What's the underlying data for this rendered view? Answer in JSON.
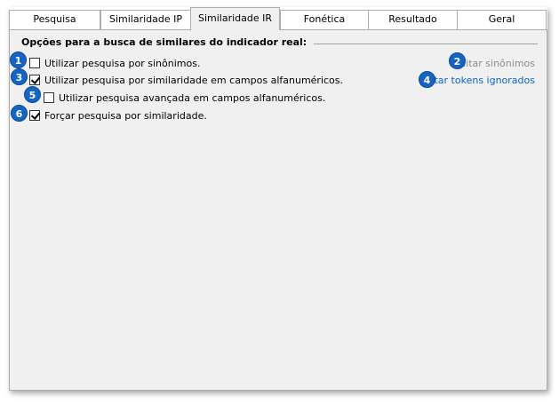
{
  "tabs": [
    {
      "label": "Pesquisa"
    },
    {
      "label": "Similaridade IP"
    },
    {
      "label": "Similaridade IR"
    },
    {
      "label": "Fonética"
    },
    {
      "label": "Resultado"
    },
    {
      "label": "Geral"
    }
  ],
  "active_tab": "Similaridade IR",
  "group": {
    "title": "Opções para a busca de similares do indicador real:"
  },
  "options": [
    {
      "label": "Utilizar pesquisa por sinônimos.",
      "checked": false,
      "badge": "1"
    },
    {
      "label": "Utilizar pesquisa por similaridade em campos alfanuméricos.",
      "checked": true,
      "badge": "3"
    },
    {
      "label": "Utilizar pesquisa avançada em campos alfanuméricos.",
      "checked": false,
      "badge": "5"
    },
    {
      "label": "Forçar pesquisa por similaridade.",
      "checked": true,
      "badge": "6"
    }
  ],
  "links": [
    {
      "label": "Editar sinônimos",
      "enabled": false,
      "badge": "2"
    },
    {
      "label": "Editar tokens ignorados",
      "enabled": true,
      "badge": "4"
    }
  ],
  "colors": {
    "badge": "#1565c0",
    "link": "#0a64c8",
    "disabled": "#8c8c8c",
    "panel": "#f0f0f0"
  }
}
